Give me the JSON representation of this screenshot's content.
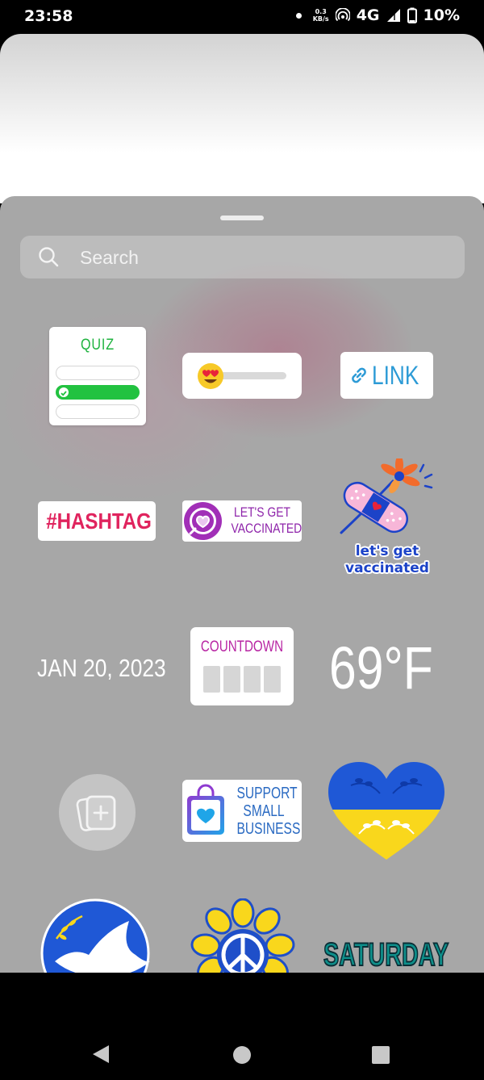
{
  "status_bar": {
    "time": "23:58",
    "net_speed_value": "0.3",
    "net_speed_unit": "KB/s",
    "network": "4G",
    "battery": "10%"
  },
  "search": {
    "placeholder": "Search"
  },
  "stickers": {
    "quiz": {
      "title": "QUIZ"
    },
    "emoji_slider": {
      "emoji": "heart-eyes"
    },
    "link": {
      "label": "LINK"
    },
    "hashtag": {
      "label": "#HASHTAG"
    },
    "vaccinated_box": {
      "line1": "LET'S GET",
      "line2": "VACCINATED"
    },
    "vaccinated_art": {
      "line1": "let's get",
      "line2": "vaccinated"
    },
    "date": {
      "label": "JAN 20, 2023"
    },
    "countdown": {
      "title": "COUNTDOWN"
    },
    "temperature": {
      "label": "69°F"
    },
    "add_yours": {
      "icon": "add-yours-icon"
    },
    "support": {
      "line1": "SUPPORT",
      "line2": "SMALL",
      "line3": "BUSINESS"
    },
    "ukraine_heart": {
      "icon": "ukraine-heart"
    },
    "dove": {
      "icon": "dove"
    },
    "sunflower_peace": {
      "icon": "sunflower-peace"
    },
    "saturday": {
      "label": "SATURDAY"
    }
  },
  "nav_bar": {
    "back": "back-icon",
    "home": "home-icon",
    "recents": "recents-icon"
  }
}
